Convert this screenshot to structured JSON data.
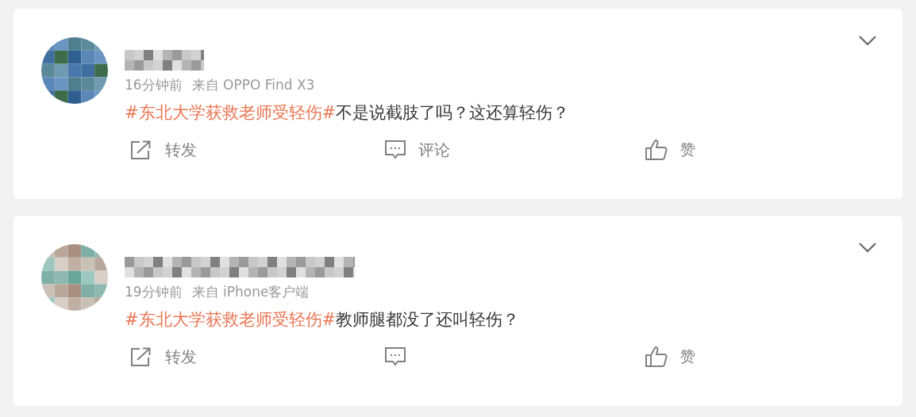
{
  "posts": [
    {
      "time": "16分钟前",
      "source": "来自 OPPO Find X3",
      "topic": "#东北大学获救老师受轻伤#",
      "text": "不是说截肢了吗？这还算轻伤？",
      "actions": [
        {
          "kind": "repost",
          "label": "转发"
        },
        {
          "kind": "comment",
          "label": "评论"
        },
        {
          "kind": "like",
          "label": "赞"
        }
      ]
    },
    {
      "time": "19分钟前",
      "source": "来自 iPhone客户端",
      "topic": "#东北大学获救老师受轻伤#",
      "text": "教师腿都没了还叫轻伤？",
      "actions": [
        {
          "kind": "repost",
          "label": "转发"
        },
        {
          "kind": "comment"
        },
        {
          "kind": "like",
          "label": "赞"
        }
      ]
    }
  ]
}
